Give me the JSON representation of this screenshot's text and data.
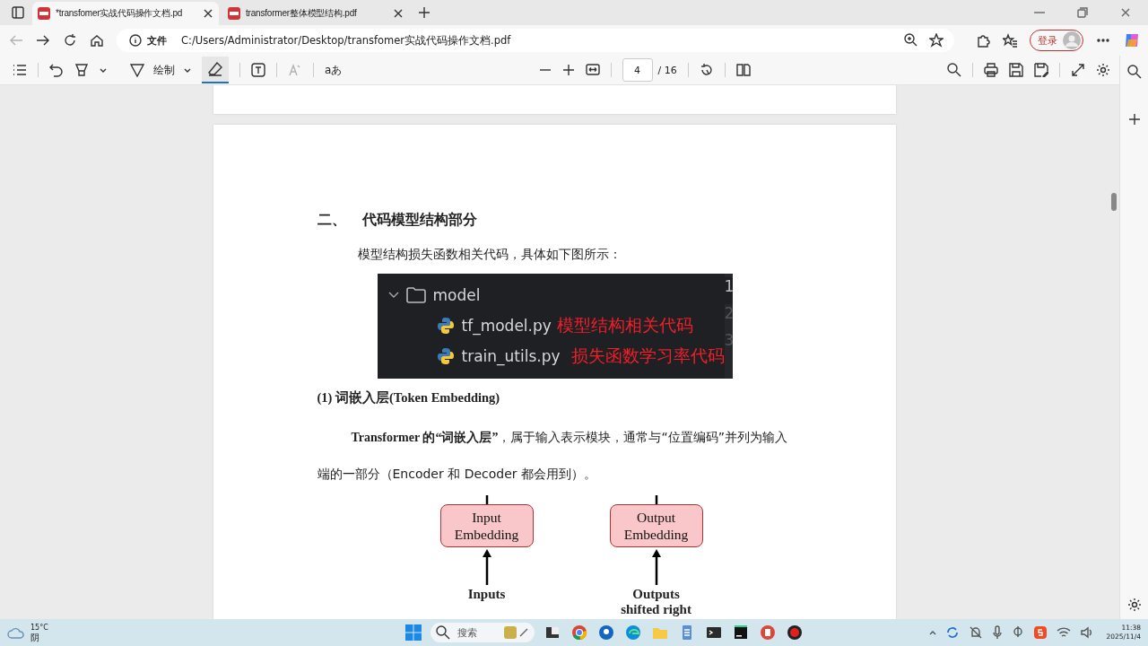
{
  "browser": {
    "tabs": [
      {
        "title": "*transfomer实战代码操作文档.pd",
        "selected": true
      },
      {
        "title": "transformer整体模型结构.pdf",
        "selected": false
      }
    ],
    "address": {
      "label": "文件",
      "url": "C:/Users/Administrator/Desktop/transfomer实战代码操作文档.pdf"
    },
    "sign_in": "登录"
  },
  "pdf_toolbar": {
    "draw_label": "绘制",
    "eraser_active": true,
    "text_sample": "aあ",
    "page": "4",
    "page_total": "/ 16"
  },
  "document": {
    "heading_number": "二、",
    "heading": "代码模型结构部分",
    "intro": "模型结构损失函数相关代码，具体如下图所示：",
    "code_figure": {
      "folder": "model",
      "expanded": true,
      "files": [
        {
          "name": "tf_model.py",
          "note": "模型结构相关代码"
        },
        {
          "name": "train_utils.py",
          "note": "损失函数学习率代码"
        }
      ],
      "line_numbers": [
        "1",
        "2",
        "3"
      ]
    },
    "subheading": "(1) 词嵌入层(Token Embedding)",
    "paragraph": "**Transformer 的“词嵌入层”**，属于输入表示模块，通常与“位置编码”并列为输入端的一部分（Encoder 和 Decoder 都会用到）。",
    "diagram": [
      {
        "box": [
          "Input",
          "Embedding"
        ],
        "input": [
          "Inputs"
        ]
      },
      {
        "box": [
          "Output",
          "Embedding"
        ],
        "input": [
          "Outputs",
          "shifted right"
        ]
      }
    ]
  },
  "taskbar": {
    "weather": {
      "temp": "15°C",
      "condition": "阴"
    },
    "search": "搜索",
    "time": "11:38",
    "date": "2025/11/4"
  }
}
